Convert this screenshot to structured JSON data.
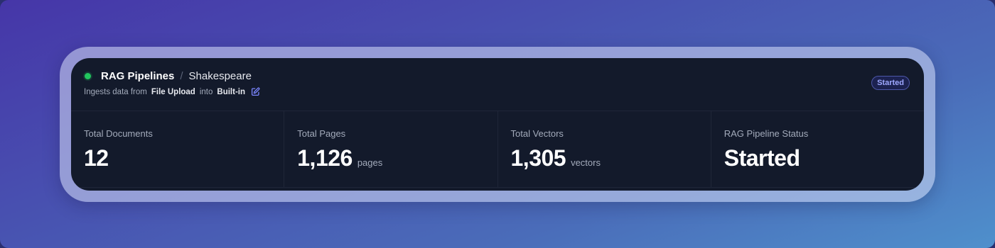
{
  "header": {
    "breadcrumb_root": "RAG Pipelines",
    "breadcrumb_separator": "/",
    "breadcrumb_current": "Shakespeare",
    "subtitle": {
      "prefix": "Ingests data from",
      "source": "File Upload",
      "middle": "into",
      "destination": "Built-in"
    },
    "status_badge": "Started",
    "status_color": "#22c55e"
  },
  "stats": [
    {
      "label": "Total Documents",
      "value": "12",
      "unit": ""
    },
    {
      "label": "Total Pages",
      "value": "1,126",
      "unit": "pages"
    },
    {
      "label": "Total Vectors",
      "value": "1,305",
      "unit": "vectors"
    },
    {
      "label": "RAG Pipeline Status",
      "value": "Started",
      "unit": ""
    }
  ],
  "icons": {
    "status": "status-dot-icon",
    "edit": "edit-pencil-icon"
  },
  "colors": {
    "card_bg": "#131a2b",
    "accent": "#9ea8ff",
    "status_green": "#22c55e"
  }
}
